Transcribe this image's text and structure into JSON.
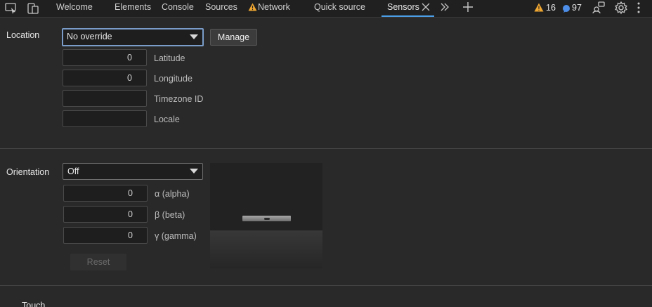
{
  "toolbar": {
    "tabs": [
      {
        "label": "Welcome"
      },
      {
        "label": "Elements"
      },
      {
        "label": "Console"
      },
      {
        "label": "Sources"
      },
      {
        "label": "Network"
      },
      {
        "label": "Quick source"
      },
      {
        "label": "Sensors"
      }
    ],
    "active_tab": "Sensors",
    "warnings_count": "16",
    "messages_count": "97",
    "icons": [
      "inspect-icon",
      "device-toolbar-icon",
      "warning-icon",
      "close-icon",
      "more-tabs-icon",
      "add-tab-icon",
      "message-icon",
      "feedback-icon",
      "settings-icon",
      "more-options-icon"
    ],
    "colors": {
      "accent": "#4c9fe6",
      "warning": "#f0a732",
      "message": "#4d8ee8"
    }
  },
  "location": {
    "label": "Location",
    "select_value": "No override",
    "manage_label": "Manage",
    "latitude_value": "0",
    "latitude_label": "Latitude",
    "longitude_value": "0",
    "longitude_label": "Longitude",
    "timezone_value": "",
    "timezone_label": "Timezone ID",
    "locale_value": "",
    "locale_label": "Locale"
  },
  "orientation": {
    "label": "Orientation",
    "select_value": "Off",
    "alpha_value": "0",
    "alpha_label": "α (alpha)",
    "beta_value": "0",
    "beta_label": "β (beta)",
    "gamma_value": "0",
    "gamma_label": "γ (gamma)",
    "reset_label": "Reset"
  },
  "touch": {
    "label": "Touch"
  }
}
